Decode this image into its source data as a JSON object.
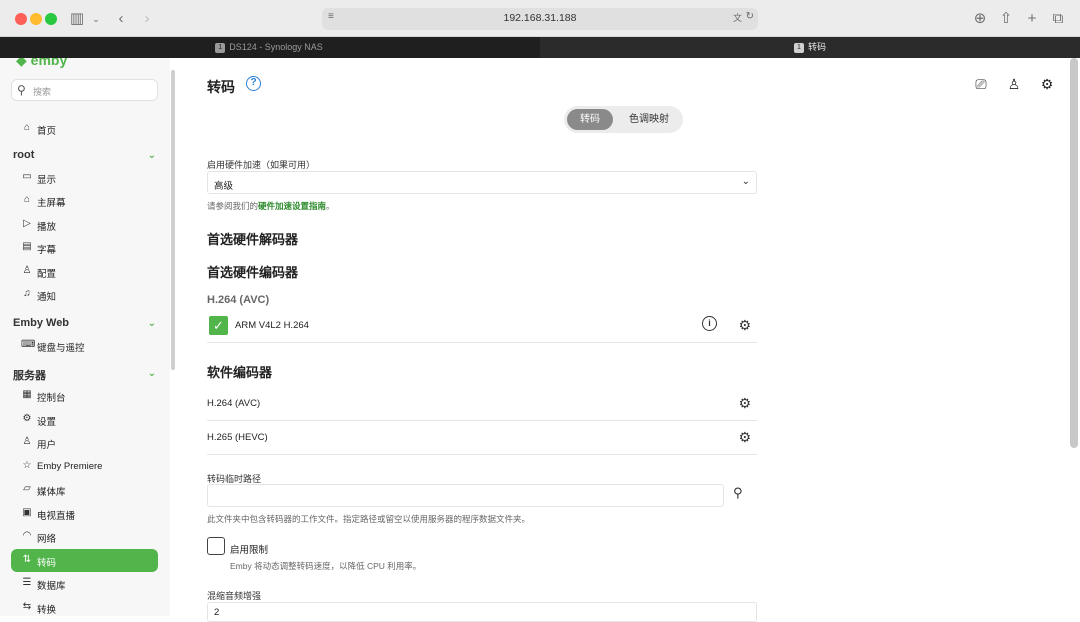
{
  "browser": {
    "url": "192.168.31.188",
    "tabs": [
      {
        "badge": "1",
        "title": "DS124 - Synology NAS"
      },
      {
        "badge": "1",
        "title": "转码"
      }
    ]
  },
  "sidebar": {
    "logo": "emby",
    "search_placeholder": "搜索",
    "home": "首页",
    "groups": [
      {
        "title": "root",
        "items": [
          "显示",
          "主屏幕",
          "播放",
          "字幕",
          "配置",
          "通知"
        ]
      },
      {
        "title": "Emby Web",
        "items": [
          "键盘与遥控"
        ]
      },
      {
        "title": "服务器",
        "items": [
          "控制台",
          "设置",
          "用户",
          "Emby Premiere",
          "媒体库",
          "电视直播",
          "网络",
          "转码",
          "数据库",
          "转换"
        ]
      }
    ],
    "active_item": "转码"
  },
  "main": {
    "title": "转码",
    "segments": [
      "转码",
      "色调映射"
    ],
    "hw_accel_label": "启用硬件加速（如果可用）",
    "hw_accel_value": "高级",
    "hint_prefix": "请参阅我们的",
    "hint_link": "硬件加速设置指南",
    "hint_suffix": "。",
    "decoder_heading": "首选硬件解码器",
    "encoder_heading": "首选硬件编码器",
    "codec_heading": "H.264 (AVC)",
    "hw_encoder": "ARM V4L2 H.264",
    "sw_heading": "软件编码器",
    "sw_encoders": [
      "H.264 (AVC)",
      "H.265 (HEVC)"
    ],
    "temp_path_label": "转码临时路径",
    "temp_path_value": "",
    "temp_path_hint": "此文件夹中包含转码器的工作文件。指定路径或留空以使用服务器的程序数据文件夹。",
    "throttle_label": "启用限制",
    "throttle_hint": "Emby 将动态调整转码速度，以降低 CPU 利用率。",
    "downmix_label": "混缩音频增强",
    "downmix_value": "2"
  },
  "colors": {
    "accent": "#52b54b",
    "link": "#2c8a2c",
    "help": "#2a7fd4"
  }
}
